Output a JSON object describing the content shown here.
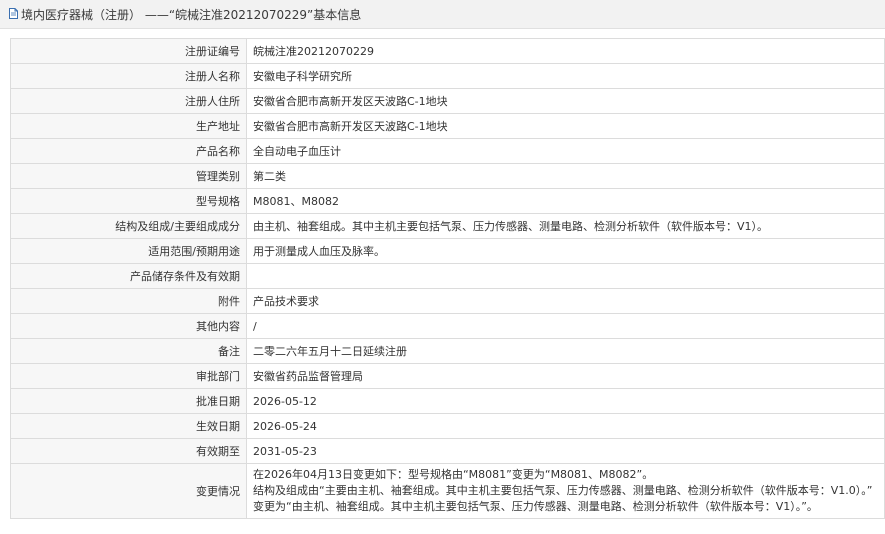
{
  "header": {
    "title": "境内医疗器械（注册） ——“皖械注准20212070229”基本信息",
    "icon": "document-icon"
  },
  "rows": [
    {
      "label": "注册证编号",
      "value": "皖械注准20212070229"
    },
    {
      "label": "注册人名称",
      "value": "安徽电子科学研究所"
    },
    {
      "label": "注册人住所",
      "value": "安徽省合肥市高新开发区天波路C-1地块"
    },
    {
      "label": "生产地址",
      "value": "安徽省合肥市高新开发区天波路C-1地块"
    },
    {
      "label": "产品名称",
      "value": "全自动电子血压计"
    },
    {
      "label": "管理类别",
      "value": "第二类"
    },
    {
      "label": "型号规格",
      "value": "M8081、M8082"
    },
    {
      "label": "结构及组成/主要组成成分",
      "value": "由主机、袖套组成。其中主机主要包括气泵、压力传感器、测量电路、检测分析软件（软件版本号：V1）。"
    },
    {
      "label": "适用范围/预期用途",
      "value": "用于测量成人血压及脉率。"
    },
    {
      "label": "产品储存条件及有效期",
      "value": ""
    },
    {
      "label": "附件",
      "value": "产品技术要求"
    },
    {
      "label": "其他内容",
      "value": "/"
    },
    {
      "label": "备注",
      "value": "二零二六年五月十二日延续注册"
    },
    {
      "label": "审批部门",
      "value": "安徽省药品监督管理局"
    },
    {
      "label": "批准日期",
      "value": "2026-05-12"
    },
    {
      "label": "生效日期",
      "value": "2026-05-24"
    },
    {
      "label": "有效期至",
      "value": "2031-05-23"
    }
  ],
  "change": {
    "label": "变更情况",
    "lines": [
      "在2026年04月13日变更如下：型号规格由“M8081”变更为“M8081、M8082”。",
      "结构及组成由“主要由主机、袖套组成。其中主机主要包括气泵、压力传感器、测量电路、检测分析软件（软件版本号：V1.0）。”",
      "变更为“由主机、袖套组成。其中主机主要包括气泵、压力传感器、测量电路、检测分析软件（软件版本号：V1）。”。"
    ]
  }
}
